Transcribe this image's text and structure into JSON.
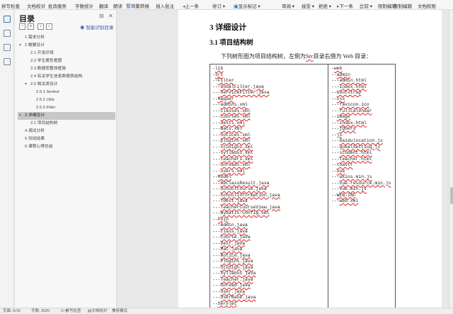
{
  "ribbon": {
    "items": [
      "拼写检查",
      "文档校对",
      "批改服务",
      "字数统计",
      "翻译",
      "朗读",
      "简繁转换",
      "插入批注",
      "上一条",
      "修订",
      "显示标记",
      "审阅",
      "接受",
      "拒绝",
      "下一条",
      "比较",
      "限制编辑",
      "限制编辑",
      "文档权限"
    ]
  },
  "nav": {
    "title": "目录",
    "smart_toc": "智能识别目录",
    "items": [
      {
        "label": "1 需求分析",
        "arrow": ""
      },
      {
        "label": "2 概要设计",
        "arrow": "▾"
      },
      {
        "label": "2.1 开发环境",
        "arrow": ""
      },
      {
        "label": "2.2 学生属性框图",
        "arrow": ""
      },
      {
        "label": "2.3 数据库整体框架",
        "arrow": ""
      },
      {
        "label": "2.4 有关学生信息数据表结构",
        "arrow": ""
      },
      {
        "label": "2.5 相关类设计",
        "arrow": "▾"
      },
      {
        "label": "2.5.1 Serlevt",
        "arrow": ""
      },
      {
        "label": "2.5.2 Utils",
        "arrow": ""
      },
      {
        "label": "2.5.3 Filter",
        "arrow": ""
      },
      {
        "label": "3 详细设计",
        "arrow": "▾"
      },
      {
        "label": "3.1 项目结构树",
        "arrow": ""
      },
      {
        "label": "4 调试分析",
        "arrow": ""
      },
      {
        "label": "5 测试结果",
        "arrow": ""
      },
      {
        "label": "6 课程心得总结",
        "arrow": ""
      }
    ]
  },
  "doc": {
    "heading1": "3  详细设计",
    "heading2": "3.1  项目结构树",
    "intro_pre": "下列树形图为项目结构树，左侧为",
    "intro_src": "Src",
    "intro_post": "目录右侧为 Web 目录：",
    "left_col": [
      "-lib",
      "-src",
      "--Filter",
      "---GobalFilter.java",
      "---ServiceFilter.java",
      "--Mapper",
      "---admins.xml",
      "---classes.xml",
      "---courses.xml",
      "---dests.xml",
      "---macs.xml",
      "---notices.xml",
      "---plugins.xml",
      "---stuSigns.xml",
      "---syllabus.xml",
      "---teachers.xml",
      "---unreads.xml",
      "---users.xml",
      "--Model",
      "---AbClassResult.java",
      "---SchoolCourse.java",
      "---SchoolInformation.java",
      "---TDest.java",
      "---TeacherCourseView.java",
      "---mybatis-config.xml",
      "--Pojo",
      "---Admin.java",
      "---Class.java",
      "---Course.java",
      "---Dest.java",
      "---Mac.java",
      "---Notice.java",
      "---Plugins.java",
      "---StuSign.java",
      "---Syllabus.java",
      "---Teacher.java",
      "---Unread.java",
      "---User.java",
      "---UserBase.java",
      "--Servlet"
    ],
    "right_col": [
      "-web",
      "--admin",
      "---admin.html",
      "---index.html",
      "--bootstrap",
      "--css",
      "---favicon.ico",
      "---fullcalendar",
      "--image",
      "---index.html",
      "---jQuery",
      "--js",
      "---baidulocation.js",
      "---gobalSetting.js",
      "---student.html",
      "---teacher.html",
      "--toastr",
      "--vue",
      "---axios.min.js",
      "---vue-resource.min.js",
      "---vue.min.js",
      "--WEB-INF",
      "---web.xml"
    ]
  },
  "status": {
    "page": "页面: 6/15",
    "words": "字数: 2620",
    "spell": "拼写检查",
    "proof": "文档校对",
    "compat": "兼容模式"
  }
}
